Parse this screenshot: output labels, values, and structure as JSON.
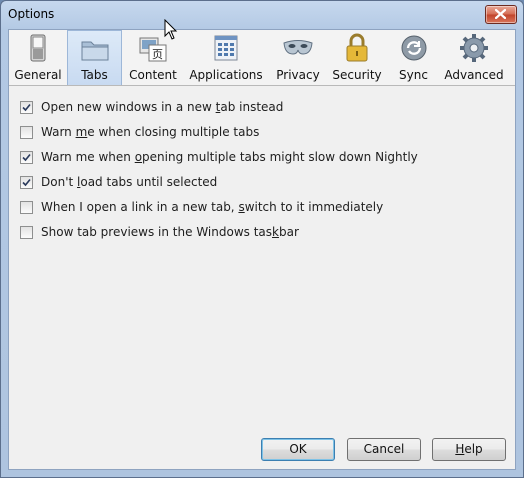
{
  "window": {
    "title": "Options"
  },
  "toolbar": {
    "tabs": [
      {
        "label": "General",
        "icon": "switch-icon"
      },
      {
        "label": "Tabs",
        "icon": "folder-icon",
        "selected": true
      },
      {
        "label": "Content",
        "icon": "content-icon"
      },
      {
        "label": "Applications",
        "icon": "applications-icon"
      },
      {
        "label": "Privacy",
        "icon": "mask-icon"
      },
      {
        "label": "Security",
        "icon": "padlock-icon"
      },
      {
        "label": "Sync",
        "icon": "sync-icon"
      },
      {
        "label": "Advanced",
        "icon": "gear-icon"
      }
    ]
  },
  "options": [
    {
      "pre": "Open new windows in a new ",
      "u": "t",
      "post": "ab instead",
      "checked": true
    },
    {
      "pre": "Warn ",
      "u": "m",
      "post": "e when closing multiple tabs",
      "checked": false
    },
    {
      "pre": "Warn me when ",
      "u": "o",
      "post": "pening multiple tabs might slow down Nightly",
      "checked": true
    },
    {
      "pre": "Don't ",
      "u": "l",
      "post": "oad tabs until selected",
      "checked": true
    },
    {
      "pre": "When I open a link in a new tab, ",
      "u": "s",
      "post": "witch to it immediately",
      "checked": false
    },
    {
      "pre": "Show tab previews in the Windows tas",
      "u": "k",
      "post": "bar",
      "checked": false
    }
  ],
  "buttons": {
    "ok": "OK",
    "cancel": "Cancel",
    "help_u": "H",
    "help_rest": "elp"
  }
}
